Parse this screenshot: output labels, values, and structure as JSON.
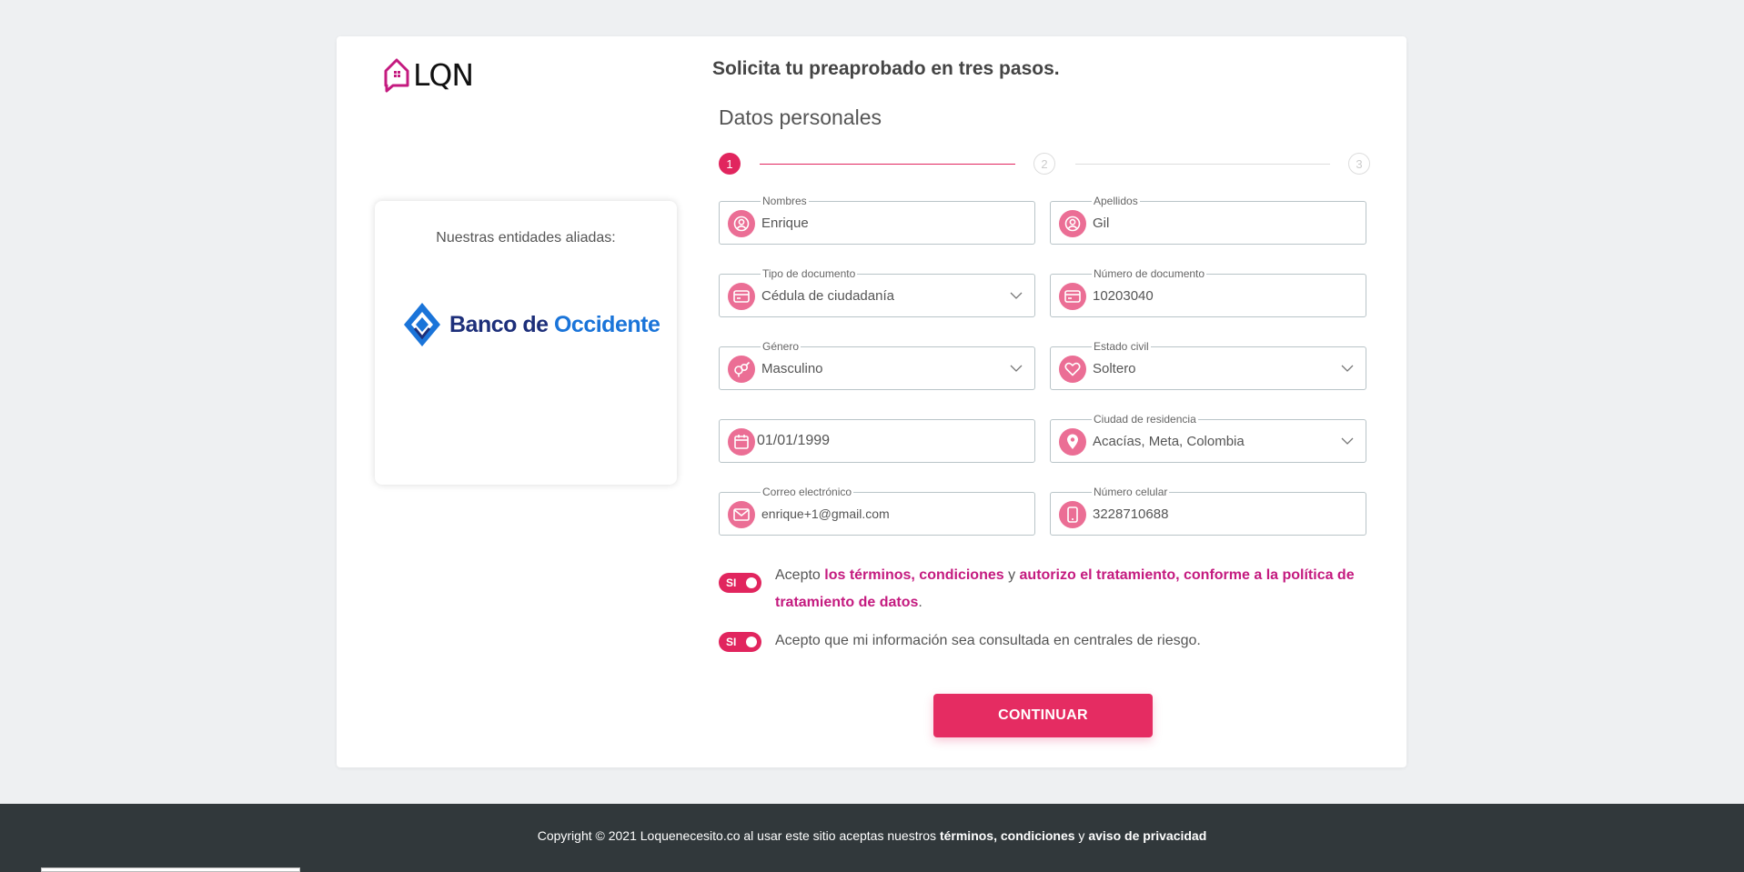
{
  "brand": {
    "logo_text": "LQN",
    "accent": "#e1255e",
    "link_color": "#c41a7f"
  },
  "allies": {
    "title": "Nuestras entidades aliadas:",
    "bank_part1": "Banco de ",
    "bank_part2": "Occidente"
  },
  "form": {
    "heading": "Solicita tu preaprobado en tres pasos.",
    "subheading": "Datos personales",
    "steps": [
      "1",
      "2",
      "3"
    ],
    "fields": {
      "nombres": {
        "label": "Nombres",
        "value": "Enrique",
        "icon": "user-icon"
      },
      "apellidos": {
        "label": "Apellidos",
        "value": "Gil",
        "icon": "user-icon"
      },
      "tipo_documento": {
        "label": "Tipo de documento",
        "value": "Cédula de ciudadanía",
        "icon": "id-card-icon"
      },
      "numero_documento": {
        "label": "Número de documento",
        "value": "10203040",
        "icon": "id-card-icon"
      },
      "genero": {
        "label": "Género",
        "value": "Masculino",
        "icon": "gender-icon"
      },
      "estado_civil": {
        "label": "Estado civil",
        "value": "Soltero",
        "icon": "heart-icon"
      },
      "fecha_nacimiento": {
        "label": "",
        "value": "01/01/1999",
        "icon": "calendar-icon"
      },
      "ciudad": {
        "label": "Ciudad de residencia",
        "value": "Acacías, Meta, Colombia",
        "icon": "location-pin-icon"
      },
      "correo": {
        "label": "Correo electrónico",
        "value": "enrique+1@gmail.com",
        "icon": "envelope-icon"
      },
      "celular": {
        "label": "Número celular",
        "value": "3228710688",
        "icon": "phone-icon"
      }
    },
    "consent1": {
      "toggle": "SI",
      "prefix": "Acepto ",
      "link1": "los términos, condiciones",
      "mid": " y ",
      "link2": "autorizo el tratamiento, conforme a la política de tratamiento de datos",
      "suffix": "."
    },
    "consent2": {
      "toggle": "SI",
      "text": "Acepto que mi información sea consultada en centrales de riesgo."
    },
    "continue_label": "CONTINUAR"
  },
  "footer": {
    "prefix": "Copyright © 2021 Loquenecesito.co al usar este sitio aceptas nuestros ",
    "bold1": "términos, condiciones",
    "mid": " y ",
    "bold2": "aviso de privacidad"
  }
}
